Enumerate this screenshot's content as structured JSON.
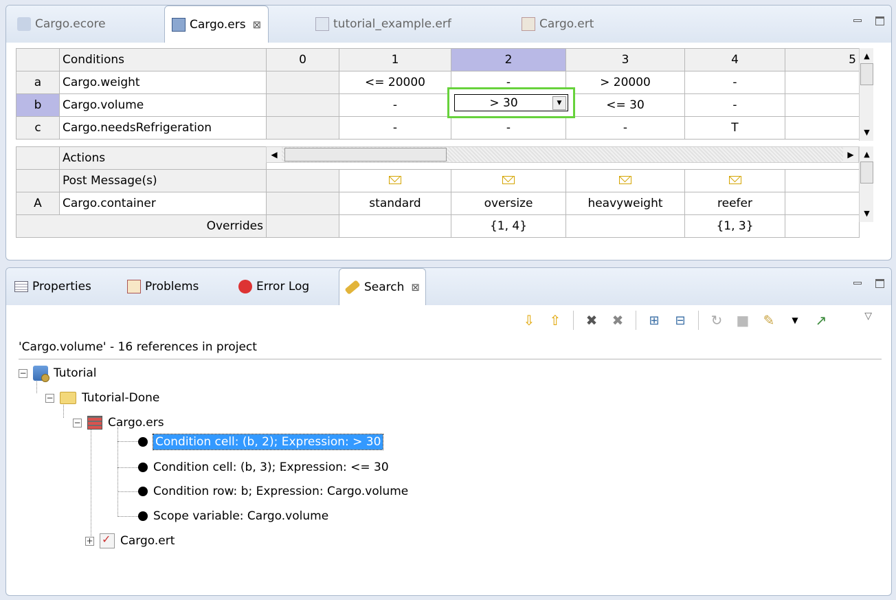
{
  "editor": {
    "tabs": [
      {
        "label": "Cargo.ecore",
        "icon": "ecore-file-icon"
      },
      {
        "label": "Cargo.ers",
        "icon": "rulesheet-icon",
        "close": "⊠"
      },
      {
        "label": "tutorial_example.erf",
        "icon": "ruleflow-icon"
      },
      {
        "label": "Cargo.ert",
        "icon": "ruletest-icon"
      }
    ],
    "conditions_header": "Conditions",
    "column_headers": [
      "0",
      "1",
      "2",
      "3",
      "4",
      "5"
    ],
    "conditions": [
      {
        "id": "a",
        "label": "Cargo.weight",
        "cells": [
          "",
          "<= 20000",
          "-",
          "> 20000",
          "-",
          ""
        ]
      },
      {
        "id": "b",
        "label": "Cargo.volume",
        "cells": [
          "",
          "-",
          "> 30",
          "<= 30",
          "-",
          ""
        ]
      },
      {
        "id": "c",
        "label": "Cargo.needsRefrigeration",
        "cells": [
          "",
          "-",
          "-",
          "-",
          "T",
          ""
        ]
      }
    ],
    "actions_header": "Actions",
    "post_message_label": "Post Message(s)",
    "actions": [
      {
        "id": "A",
        "label": "Cargo.container",
        "cells": [
          "",
          "standard",
          "oversize",
          "heavyweight",
          "reefer",
          ""
        ]
      }
    ],
    "overrides_label": "Overrides",
    "overrides": [
      "",
      "",
      "{1, 4}",
      "",
      "{1, 3}",
      ""
    ],
    "combo_value": "> 30"
  },
  "bottom": {
    "tabs": [
      {
        "label": "Properties",
        "icon": "properties-icon"
      },
      {
        "label": "Problems",
        "icon": "problems-icon"
      },
      {
        "label": "Error Log",
        "icon": "error-log-icon"
      },
      {
        "label": "Search",
        "icon": "search-icon",
        "close": "⊠"
      }
    ],
    "summary": "'Cargo.volume' - 16 references in project",
    "tree": {
      "project": "Tutorial",
      "folder": "Tutorial-Done",
      "file1": "Cargo.ers",
      "results": [
        "Condition cell: (b, 2); Expression: > 30",
        "Condition cell: (b, 3); Expression: <= 30",
        "Condition row: b; Expression: Cargo.volume",
        "Scope variable: Cargo.volume"
      ],
      "file2": "Cargo.ert"
    }
  }
}
